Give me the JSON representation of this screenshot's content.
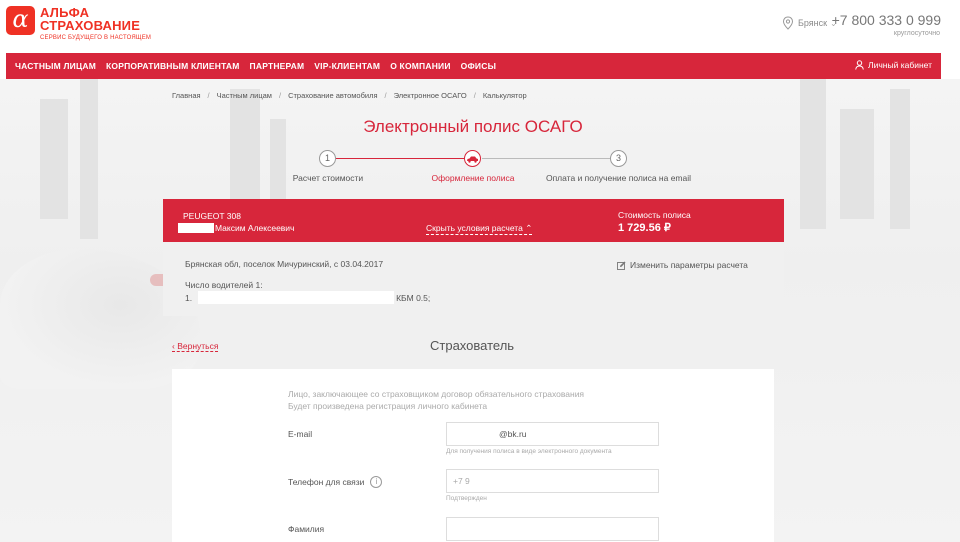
{
  "header": {
    "logo_line1": "АЛЬФА",
    "logo_line2": "СТРАХОВАНИЕ",
    "logo_tagline": "СЕРВИС БУДУЩЕГО В НАСТОЯЩЕМ",
    "logo_mark": "α",
    "city": "Брянск",
    "phone": "+7 800 333 0 999",
    "phone_note": "круглосуточно"
  },
  "nav": {
    "items": [
      "ЧАСТНЫМ ЛИЦАМ",
      "КОРПОРАТИВНЫМ КЛИЕНТАМ",
      "ПАРТНЕРАМ",
      "VIP-КЛИЕНТАМ",
      "О КОМПАНИИ",
      "ОФИСЫ"
    ],
    "account": "Личный кабинет"
  },
  "breadcrumb": [
    "Главная",
    "Частным лицам",
    "Страхование автомобиля",
    "Электронное ОСАГО",
    "Калькулятор"
  ],
  "page_title": "Электронный полис ОСАГО",
  "steps": [
    {
      "number": "1",
      "label": "Расчет стоимости"
    },
    {
      "number": "",
      "label": "Оформление полиса"
    },
    {
      "number": "3",
      "label": "Оплата и получение полиса на email"
    }
  ],
  "summary": {
    "car": "PEUGEOT 308",
    "owner": "Максим Алексеевич",
    "toggle": "Скрыть условия расчета",
    "cost_label": "Стоимость полиса",
    "cost": "1 729.56 ₽"
  },
  "details": {
    "region": "Брянская обл, поселок Мичуринский, с 03.04.2017",
    "drivers": "Число водителей 1:",
    "driver1_index": "1.",
    "driver1_kbm": "КБМ 0.5;",
    "change": "Изменить параметры расчета"
  },
  "back_link": "Вернуться",
  "section_title": "Страхователь",
  "form": {
    "hint_line1": "Лицо, заключающее со страховщиком договор обязательного страхования",
    "hint_line2": "Будет произведена регистрация личного кабинета",
    "email_label": "E-mail",
    "email_value": "@bk.ru",
    "email_note": "Для получения полиса в виде электронного документа",
    "phone_label": "Телефон для связи",
    "phone_value": "+7 9",
    "phone_note": "Подтвержден",
    "surname_label": "Фамилия",
    "surname_value": ""
  },
  "colors": {
    "brand_red": "#d7263b",
    "logo_red": "#ef3124"
  }
}
